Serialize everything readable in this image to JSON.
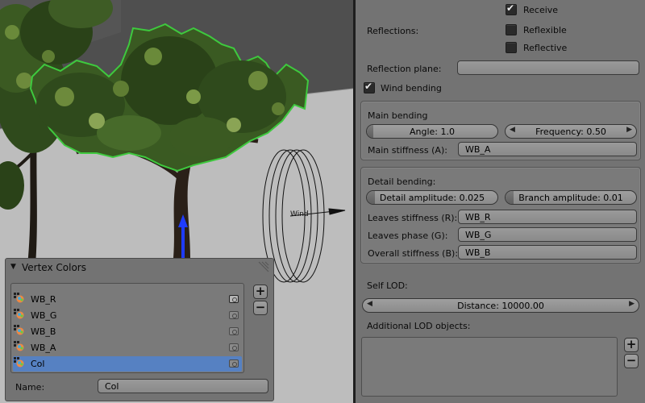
{
  "viewport": {
    "gizmo_label": "Wind"
  },
  "properties": {
    "receive_label": "Receive",
    "receive_checked": true,
    "reflections_label": "Reflections:",
    "reflexible_label": "Reflexible",
    "reflexible_checked": false,
    "reflective_label": "Reflective",
    "reflective_checked": false,
    "reflection_plane_label": "Reflection plane:",
    "reflection_plane_value": "",
    "wind_bending_label": "Wind bending",
    "wind_bending_checked": true,
    "main_bending": {
      "title": "Main bending",
      "angle_text": "Angle: 1.0",
      "angle_value": 1.0,
      "frequency_text": "Frequency: 0.50",
      "frequency_value": 0.5,
      "stiffness_label": "Main stiffness (A):",
      "stiffness_value": "WB_A"
    },
    "detail_bending": {
      "title": "Detail bending:",
      "detail_amplitude_text": "Detail amplitude: 0.025",
      "branch_amplitude_text": "Branch amplitude: 0.01",
      "leaves_stiffness_label": "Leaves stiffness (R):",
      "leaves_stiffness_value": "WB_R",
      "leaves_phase_label": "Leaves phase (G):",
      "leaves_phase_value": "WB_G",
      "overall_stiffness_label": "Overall stiffness (B):",
      "overall_stiffness_value": "WB_B"
    },
    "self_lod_label": "Self LOD:",
    "distance_text": "Distance: 10000.00",
    "additional_lod_label": "Additional LOD objects:"
  },
  "vertex_colors": {
    "title": "Vertex Colors",
    "items": [
      {
        "label": "WB_R",
        "selected": false,
        "active_render": true
      },
      {
        "label": "WB_G",
        "selected": false,
        "active_render": false
      },
      {
        "label": "WB_B",
        "selected": false,
        "active_render": false
      },
      {
        "label": "WB_A",
        "selected": false,
        "active_render": false
      },
      {
        "label": "Col",
        "selected": true,
        "active_render": false
      }
    ],
    "name_label": "Name:",
    "name_value": "Col"
  },
  "colors": {
    "selection": "#5681c2",
    "outline_green": "#3ec93e",
    "axis_blue": "#1f3cff"
  }
}
